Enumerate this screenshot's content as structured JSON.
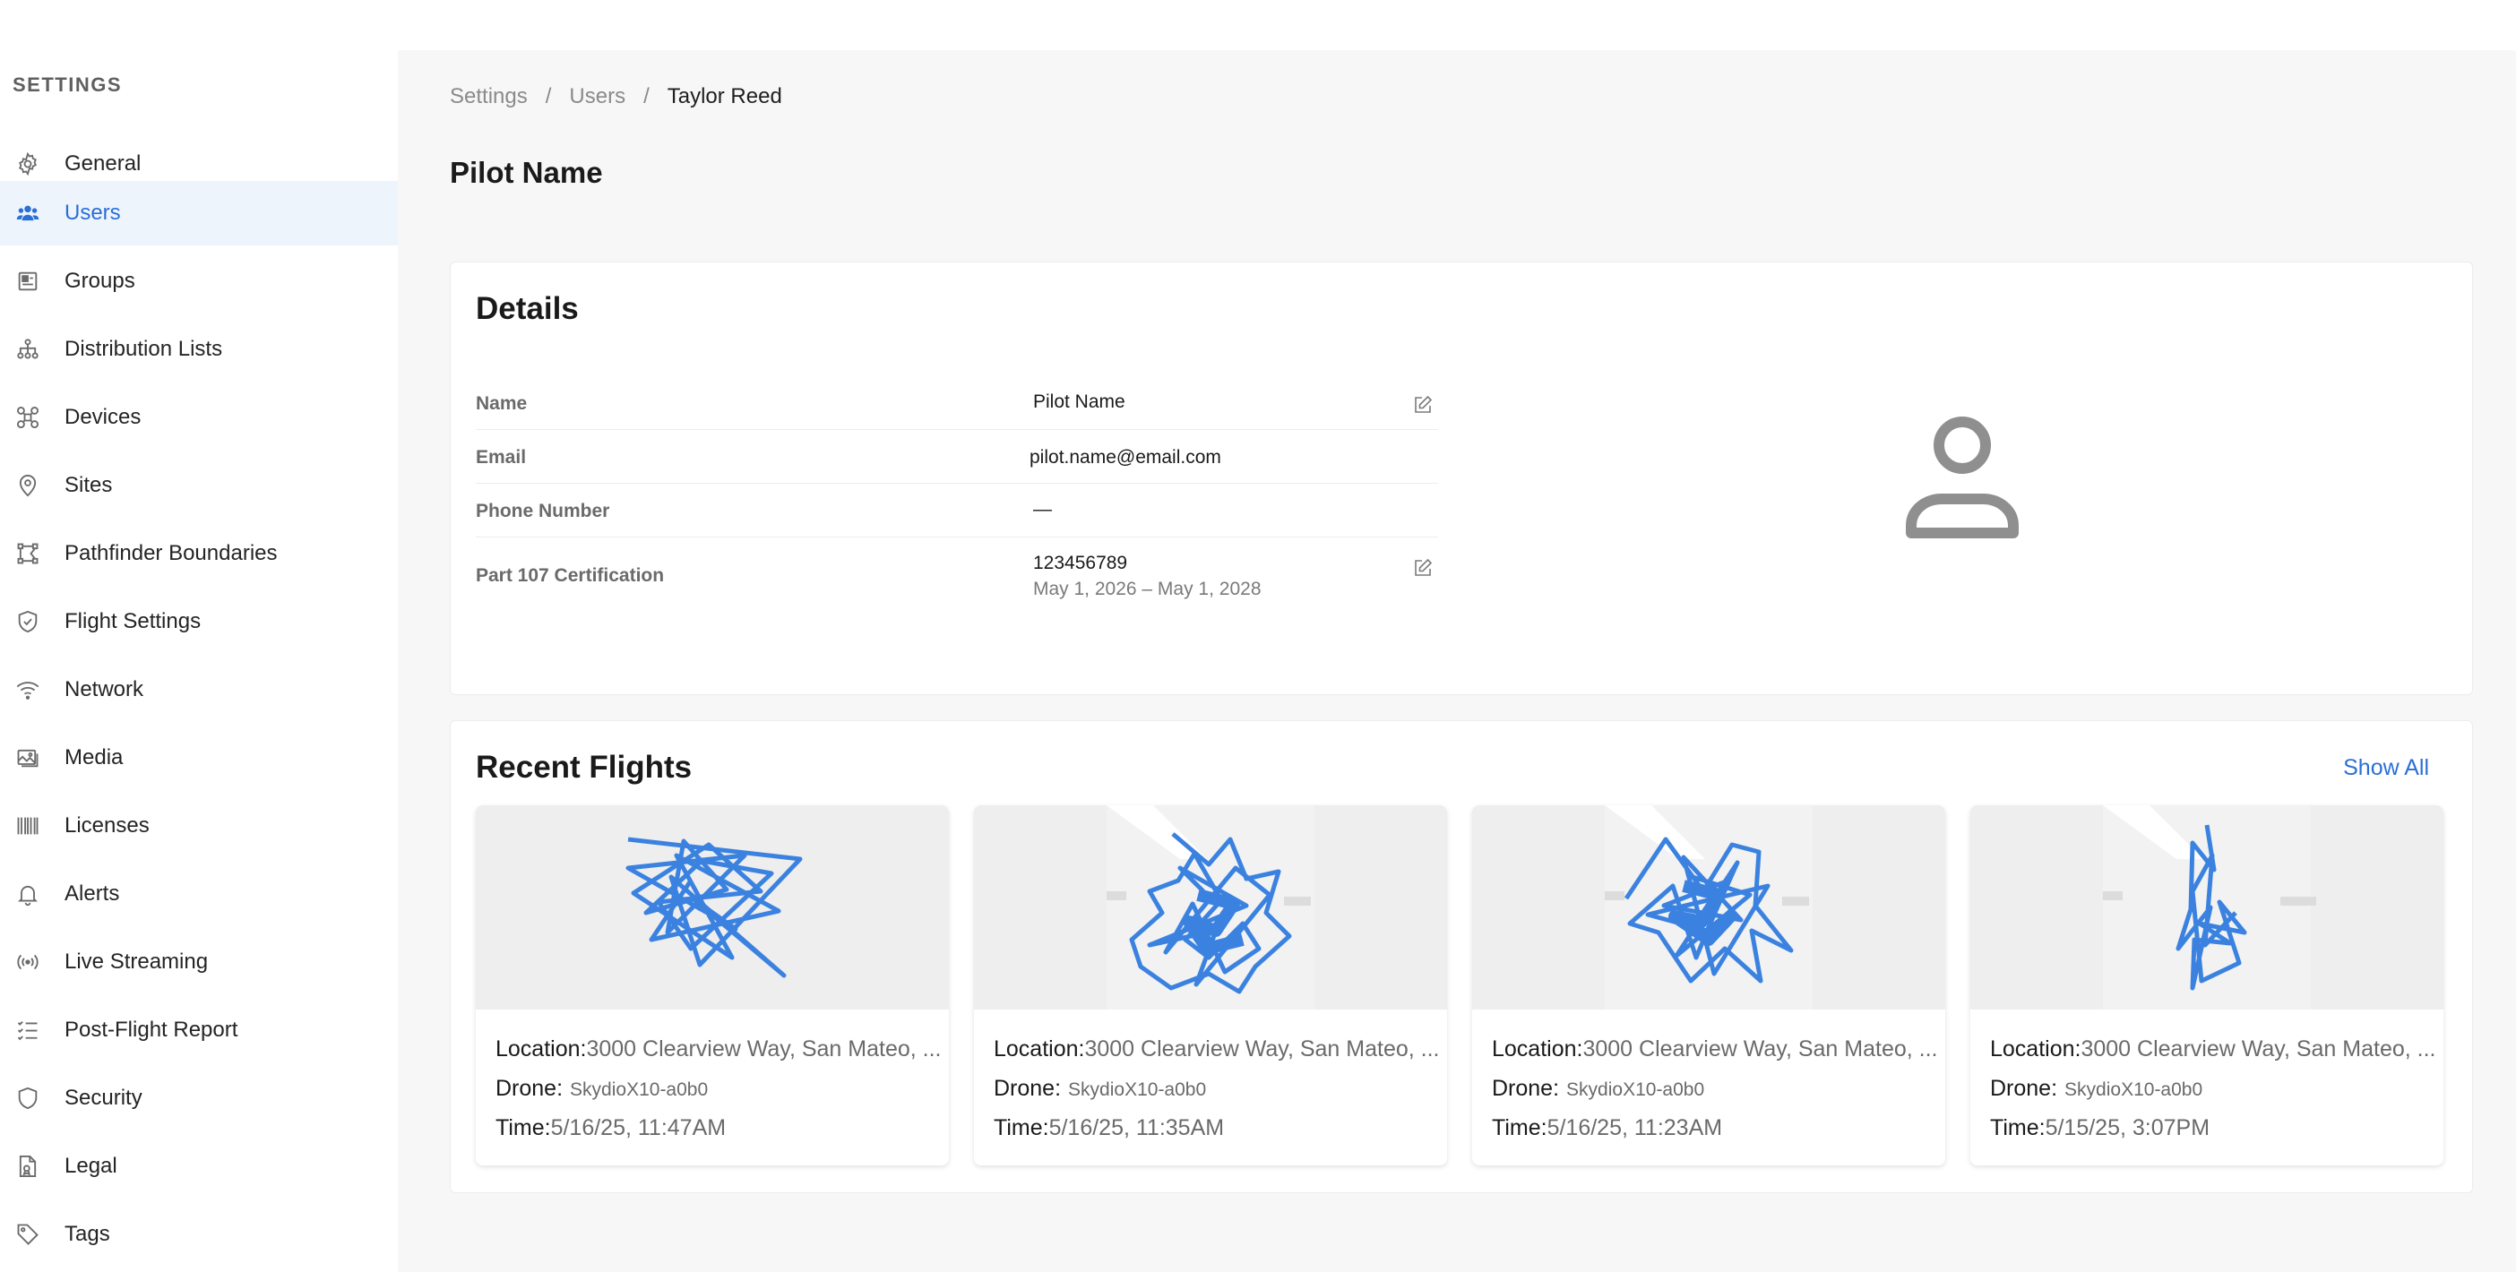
{
  "sidebar": {
    "title": "SETTINGS",
    "items": [
      {
        "label": "General",
        "icon": "gear-icon",
        "active": false
      },
      {
        "label": "Users",
        "icon": "users-icon",
        "active": true
      },
      {
        "label": "Groups",
        "icon": "groups-icon",
        "active": false
      },
      {
        "label": "Distribution Lists",
        "icon": "hierarchy-icon",
        "active": false
      },
      {
        "label": "Devices",
        "icon": "drone-icon",
        "active": false
      },
      {
        "label": "Sites",
        "icon": "location-pin-icon",
        "active": false
      },
      {
        "label": "Pathfinder Boundaries",
        "icon": "boundary-icon",
        "active": false
      },
      {
        "label": "Flight Settings",
        "icon": "shield-check-icon",
        "active": false
      },
      {
        "label": "Network",
        "icon": "wifi-icon",
        "active": false
      },
      {
        "label": "Media",
        "icon": "image-icon",
        "active": false
      },
      {
        "label": "Licenses",
        "icon": "barcode-icon",
        "active": false
      },
      {
        "label": "Alerts",
        "icon": "bell-icon",
        "active": false
      },
      {
        "label": "Live Streaming",
        "icon": "broadcast-icon",
        "active": false
      },
      {
        "label": "Post-Flight Report",
        "icon": "list-check-icon",
        "active": false
      },
      {
        "label": "Security",
        "icon": "shield-icon",
        "active": false
      },
      {
        "label": "Legal",
        "icon": "document-icon",
        "active": false
      },
      {
        "label": "Tags",
        "icon": "tag-icon",
        "active": false
      }
    ]
  },
  "breadcrumb": {
    "level1": "Settings",
    "level2": "Users",
    "current": "Taylor Reed",
    "separator": "/"
  },
  "page": {
    "title": "Pilot Name"
  },
  "details": {
    "title": "Details",
    "name_label": "Name",
    "name_value": "Pilot Name",
    "email_label": "Email",
    "email_value": "pilot.name@email.com",
    "phone_label": "Phone Number",
    "phone_value": "—",
    "cert_label": "Part 107 Certification",
    "cert_value": "123456789",
    "cert_dates": "May 1, 2026 – May 1, 2028"
  },
  "flights": {
    "title": "Recent Flights",
    "show_all": "Show All",
    "location_label": "Location:",
    "drone_label": "Drone:",
    "time_label": "Time:",
    "items": [
      {
        "location": "3000 Clearview Way, San Mateo, ...",
        "drone": "SkydioX10-a0b0",
        "time": "5/16/25, 11:47AM"
      },
      {
        "location": "3000 Clearview Way, San Mateo, ...",
        "drone": "SkydioX10-a0b0",
        "time": "5/16/25, 11:35AM"
      },
      {
        "location": "3000 Clearview Way, San Mateo, ...",
        "drone": "SkydioX10-a0b0",
        "time": "5/16/25, 11:23AM"
      },
      {
        "location": "3000 Clearview Way, San Mateo, ...",
        "drone": "SkydioX10-a0b0",
        "time": "5/15/25, 3:07PM"
      }
    ]
  },
  "colors": {
    "accent": "#2a6fd6",
    "flight_path": "#3b82e0",
    "sidebar_active_bg": "#eef4fc"
  }
}
